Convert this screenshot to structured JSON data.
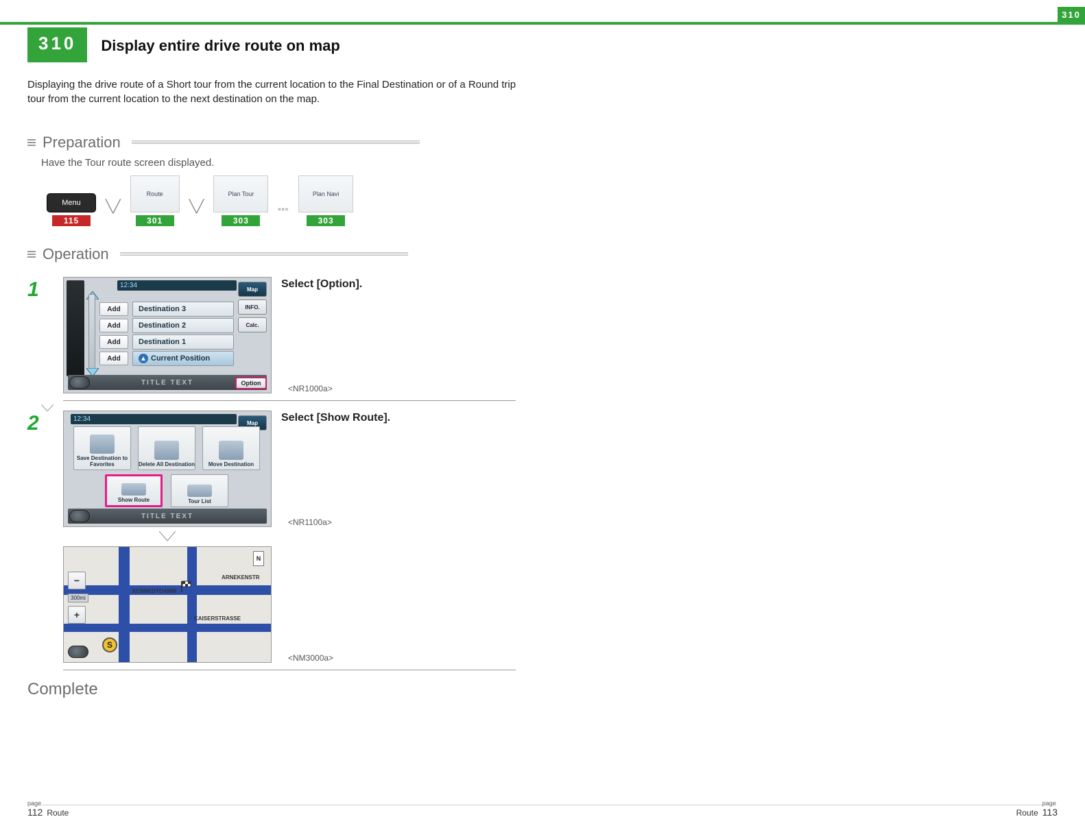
{
  "page_number": "310",
  "page_number_corner": "310",
  "title": "Display entire drive route on map",
  "intro": "Displaying the drive route of a Short tour from the current location to the Final Destination or of a Round trip tour from the current location to the next destination on the map.",
  "preparation": {
    "heading": "Preparation",
    "note": "Have the Tour route screen displayed.",
    "refs": {
      "menu": {
        "label": "Menu",
        "ref": "115"
      },
      "route": {
        "label": "Route",
        "ref": "301"
      },
      "plan_tour": {
        "label": "Plan Tour",
        "ref": "303"
      },
      "plan_navi": {
        "label": "Plan Navi",
        "ref": "303"
      }
    }
  },
  "operation": {
    "heading": "Operation",
    "steps": [
      {
        "num": "1",
        "instruction": "Select [Option].",
        "code": "<NR1000a>",
        "shot1": {
          "time": "12:34",
          "btn_add": "Add",
          "dest3": "Destination 3",
          "dest2": "Destination 2",
          "dest1": "Destination 1",
          "current": "Current Position",
          "map": "Map",
          "info": "INFO.",
          "calc": "Calc.",
          "title_text": "TITLE TEXT",
          "option": "Option"
        }
      },
      {
        "num": "2",
        "instruction": "Select [Show Route].",
        "code": "<NR1100a>",
        "map_code": "<NM3000a>",
        "shot2": {
          "time": "12:34",
          "save": "Save Destination to Favorites",
          "delete": "Delete All Destination",
          "move": "Move Destination",
          "show": "Show Route",
          "tour": "Tour List",
          "map": "Map",
          "title_text": "TITLE TEXT"
        },
        "shot3": {
          "scale": "300mi",
          "road1": "KENNEDYDAMM",
          "road2": "ARNEKENSTR",
          "road3": "KAISERSTRASSE",
          "start": "S",
          "compass": "N"
        }
      }
    ],
    "complete": "Complete"
  },
  "footer": {
    "left_page_label": "page",
    "left_page": "112",
    "left_section": "Route",
    "right_section": "Route",
    "right_page_label": "page",
    "right_page": "113"
  }
}
